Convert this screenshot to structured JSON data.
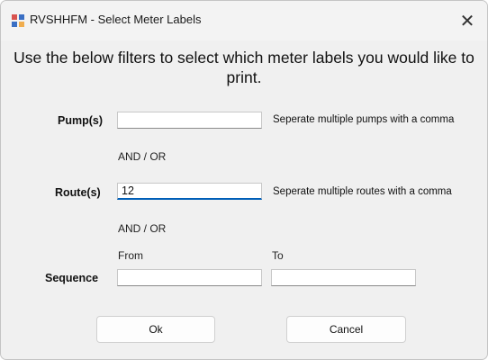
{
  "window": {
    "title": "RVSHHFM - Select Meter Labels",
    "close_glyph": "✕",
    "app_icon": "window-app-icon"
  },
  "heading": "Use the below filters to select which meter labels you would like to print.",
  "pumps": {
    "label": "Pump(s)",
    "value": "",
    "hint": "Seperate multiple pumps with a comma"
  },
  "and_or_1": "AND / OR",
  "routes": {
    "label": "Route(s)",
    "value": "12",
    "hint": "Seperate multiple routes with a comma"
  },
  "and_or_2": "AND / OR",
  "sequence": {
    "label": "Sequence",
    "from_label": "From",
    "to_label": "To",
    "from_value": "",
    "to_value": ""
  },
  "buttons": {
    "ok": "Ok",
    "cancel": "Cancel"
  },
  "colors": {
    "focus_accent": "#005fb8",
    "window_bg": "#f0f0f0"
  }
}
